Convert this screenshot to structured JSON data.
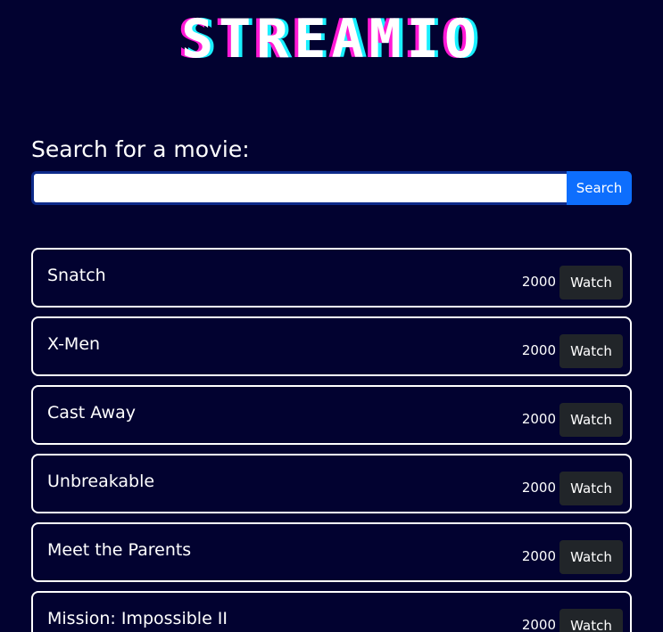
{
  "header": {
    "logo_text": "STREAMIO"
  },
  "search": {
    "label": "Search for a movie:",
    "value": "",
    "placeholder": "",
    "button_label": "Search"
  },
  "colors": {
    "background": "#020230",
    "search_button": "#0d6efd",
    "watch_button": "#212529",
    "logo_pink": "#ff19d6",
    "logo_cyan": "#19f0ff"
  },
  "movies": [
    {
      "title": "Snatch",
      "year": "2000",
      "action_label": "Watch"
    },
    {
      "title": "X-Men",
      "year": "2000",
      "action_label": "Watch"
    },
    {
      "title": "Cast Away",
      "year": "2000",
      "action_label": "Watch"
    },
    {
      "title": "Unbreakable",
      "year": "2000",
      "action_label": "Watch"
    },
    {
      "title": "Meet the Parents",
      "year": "2000",
      "action_label": "Watch"
    },
    {
      "title": "Mission: Impossible II",
      "year": "2000",
      "action_label": "Watch"
    }
  ]
}
